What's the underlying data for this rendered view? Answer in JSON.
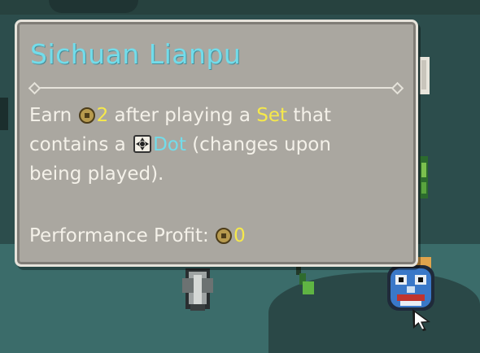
{
  "tooltip": {
    "title": "Sichuan Lianpu",
    "desc_prefix": "Earn ",
    "coin_amount": "2",
    "desc_after_coin": " after playing a ",
    "set_keyword": "Set",
    "desc_after_set": " that contains a ",
    "dot_keyword": "Dot",
    "desc_suffix": " (changes upon being played).",
    "profit_label": "Performance Profit: ",
    "profit_value": "0"
  },
  "icons": {
    "coin": "coin-icon",
    "dot_tile": "dot-tile-icon",
    "cursor": "mouse-pointer-icon",
    "bell": "bell-tile-icon",
    "mask": "opera-mask-icon"
  },
  "colors": {
    "title": "#72dcea",
    "keyword_yellow": "#f6e94a",
    "keyword_blue": "#72dcea",
    "panel_bg": "#aaa7a0",
    "panel_border": "#e6e3db",
    "board_bg": "#2c4d4c"
  }
}
